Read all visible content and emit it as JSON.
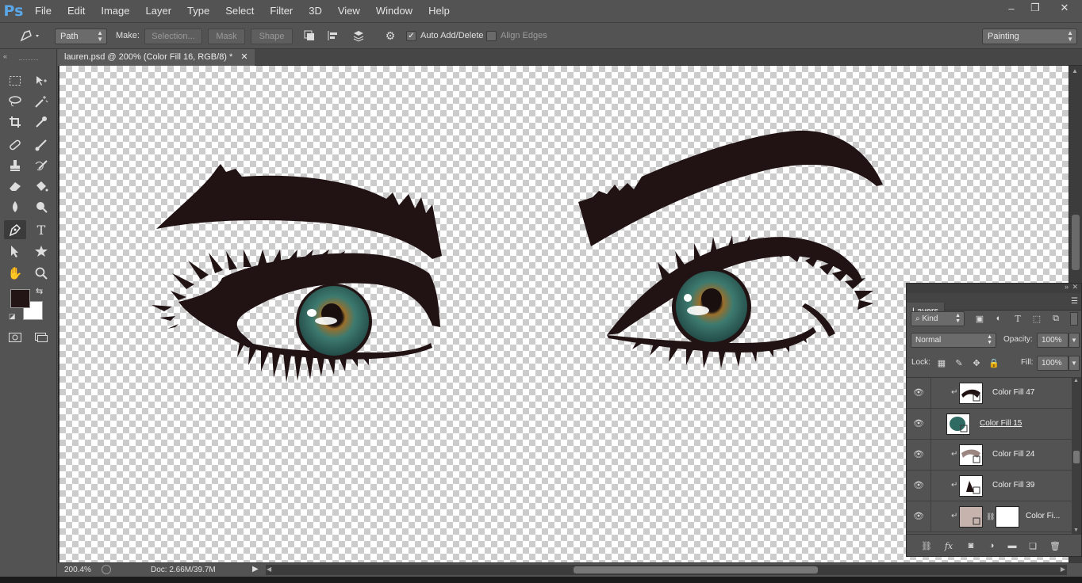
{
  "app": {
    "logo": "Ps"
  },
  "menu": [
    "File",
    "Edit",
    "Image",
    "Layer",
    "Type",
    "Select",
    "Filter",
    "3D",
    "View",
    "Window",
    "Help"
  ],
  "window_controls": {
    "minimize": "–",
    "restore": "❐",
    "close": "✕"
  },
  "options": {
    "mode_select": "Path",
    "make_label": "Make:",
    "selection_btn": "Selection...",
    "mask_btn": "Mask",
    "shape_btn": "Shape",
    "auto_add_delete": "Auto Add/Delete",
    "auto_add_checked": true,
    "align_edges": "Align Edges",
    "align_edges_checked": false,
    "workspace": "Painting"
  },
  "document": {
    "tab_title": "lauren.psd @ 200% (Color Fill 16, RGB/8) *",
    "close": "✕"
  },
  "status": {
    "zoom": "200.4%",
    "doc": "Doc: 2.66M/39.7M"
  },
  "colors": {
    "foreground": "#231415",
    "background": "#ffffff",
    "ink": "#211213",
    "iris_outer": "#2f6a63",
    "iris_inner": "#8a6b2a"
  },
  "layers_panel": {
    "title": "Layers",
    "kind_filter": "Kind",
    "blend_mode": "Normal",
    "opacity_label": "Opacity:",
    "opacity": "100%",
    "lock_label": "Lock:",
    "fill_label": "Fill:",
    "fill": "100%",
    "layers": [
      {
        "name": "Color Fill 47",
        "visible": true,
        "clipped": true,
        "selected": false
      },
      {
        "name": "Color Fill 15",
        "visible": true,
        "clipped": false,
        "selected": false
      },
      {
        "name": "Color Fill 24",
        "visible": true,
        "clipped": true,
        "selected": false
      },
      {
        "name": "Color Fill 39",
        "visible": true,
        "clipped": true,
        "selected": false
      },
      {
        "name": "Color Fi...",
        "visible": true,
        "clipped": true,
        "selected": false
      }
    ]
  }
}
